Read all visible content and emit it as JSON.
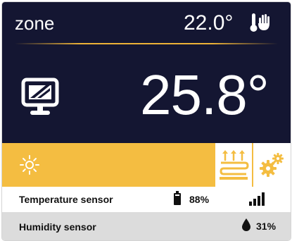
{
  "header": {
    "zone_label": "zone",
    "setpoint": "22.0°"
  },
  "main": {
    "current_temperature": "25.8°"
  },
  "mode_bar": {
    "active_mode_icon": "sun-icon",
    "heating_icon": "underfloor-heating-icon",
    "settings_icon": "gears-icon"
  },
  "sensors": [
    {
      "label": "Temperature sensor",
      "battery_icon": "battery-icon",
      "battery": "88%",
      "signal_icon": "signal-bars-icon"
    },
    {
      "label": "Humidity sensor",
      "humidity_icon": "water-drop-icon",
      "humidity": "31%"
    }
  ],
  "colors": {
    "background_dark": "#141632",
    "accent": "#f4bd41",
    "text_light": "#ffffff",
    "row_alt": "#dcdcdc"
  }
}
